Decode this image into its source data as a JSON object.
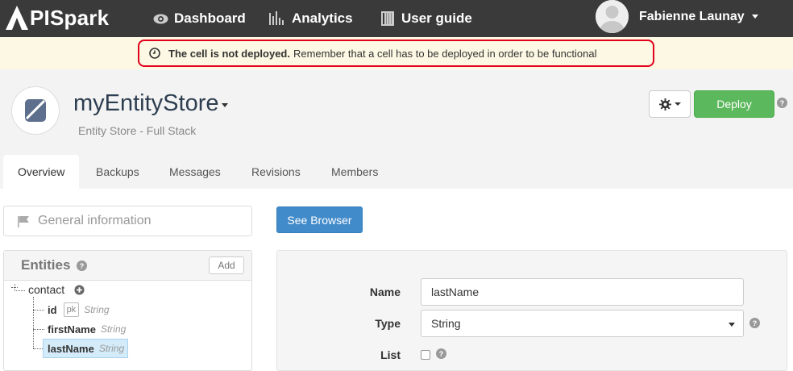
{
  "brand": {
    "logo_text": "PISpark",
    "logo_mark_letter": "A"
  },
  "nav": {
    "dashboard": "Dashboard",
    "analytics": "Analytics",
    "user_guide": "User guide",
    "user_name": "Fabienne Launay"
  },
  "alert": {
    "strong": "The cell is not deployed.",
    "text": "Remember that a cell has to be deployed in order to be functional"
  },
  "cell": {
    "title": "myEntityStore",
    "subtitle": "Entity Store - Full Stack",
    "deploy_label": "Deploy"
  },
  "tabs": [
    {
      "label": "Overview",
      "active": true
    },
    {
      "label": "Backups",
      "active": false
    },
    {
      "label": "Messages",
      "active": false
    },
    {
      "label": "Revisions",
      "active": false
    },
    {
      "label": "Members",
      "active": false
    }
  ],
  "sidebar": {
    "general_info": "General information",
    "entities_title": "Entities",
    "add_label": "Add",
    "entity": {
      "name": "contact",
      "fields": [
        {
          "name": "id",
          "badge": "pk",
          "type": "String"
        },
        {
          "name": "firstName",
          "type": "String"
        },
        {
          "name": "lastName",
          "type": "String",
          "selected": true
        }
      ]
    }
  },
  "main": {
    "see_browser": "See Browser",
    "form": {
      "name_label": "Name",
      "name_value": "lastName",
      "type_label": "Type",
      "type_value": "String",
      "list_label": "List",
      "list_checked": false
    }
  },
  "colors": {
    "topbar": "#3a3a3a",
    "alert_bg": "#fcf8e3",
    "alert_border": "#e2001a",
    "deploy": "#5cb85c",
    "see_browser": "#428bca",
    "selected_node": "#d4ebfa"
  },
  "icons": {
    "dashboard": "eye-icon",
    "analytics": "bar-chart-icon",
    "user_guide": "book-icon",
    "alert": "clock-icon",
    "general_info": "flag-icon",
    "help": "question-circle-icon",
    "add_entity_field": "plus-circle-icon",
    "settings": "gear-icon"
  }
}
